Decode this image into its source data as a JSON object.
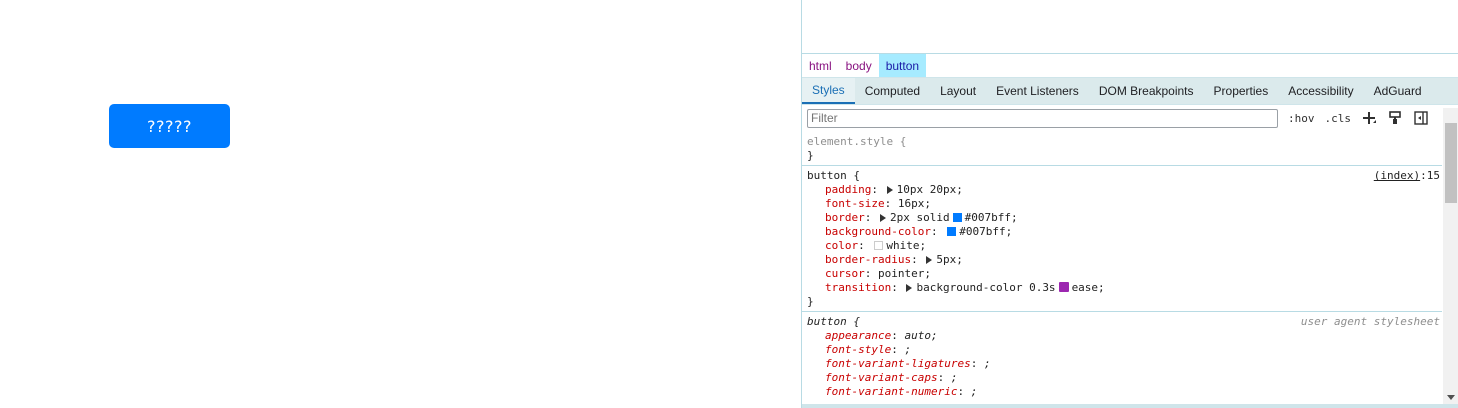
{
  "page": {
    "button_label": "?????"
  },
  "devtools": {
    "breadcrumbs": [
      "html",
      "body",
      "button"
    ],
    "tabs": [
      "Styles",
      "Computed",
      "Layout",
      "Event Listeners",
      "DOM Breakpoints",
      "Properties",
      "Accessibility",
      "AdGuard"
    ],
    "active_tab": "Styles",
    "filter_placeholder": "Filter",
    "tools": {
      "hov": ":hov",
      "cls": ".cls"
    },
    "icons": [
      "add-rule-icon",
      "paint-brush-icon",
      "toggle-sidebar-icon"
    ],
    "element_style": {
      "selector": "element.style {",
      "close": "}"
    },
    "button_rule": {
      "selector": "button {",
      "source_file": "(index)",
      "source_line": ":15",
      "padding_prop": "padding",
      "padding_val": "10px 20px;",
      "font_size_prop": "font-size",
      "font_size_val": "16px;",
      "border_prop": "border",
      "border_val_pre": "2px solid",
      "border_color": "#007bff;",
      "bg_prop": "background-color",
      "bg_color": "#007bff;",
      "color_prop": "color",
      "color_val": "white;",
      "radius_prop": "border-radius",
      "radius_val": "5px;",
      "cursor_prop": "cursor",
      "cursor_val": "pointer;",
      "transition_prop": "transition",
      "transition_val_pre": "background-color 0.3s",
      "transition_val_post": "ease;",
      "close": "}"
    },
    "ua_rule": {
      "selector": "button {",
      "source": "user agent stylesheet",
      "appearance_prop": "appearance",
      "appearance_val": "auto;",
      "font_style_prop": "font-style",
      "font_style_val": ";",
      "ligatures_prop": "font-variant-ligatures",
      "ligatures_val": ";",
      "caps_prop": "font-variant-caps",
      "caps_val": ";",
      "numeric_prop": "font-variant-numeric",
      "numeric_val": ";"
    },
    "colors": {
      "accent": "#007bff",
      "white": "#ffffff",
      "ease": "#9c27b0"
    }
  }
}
